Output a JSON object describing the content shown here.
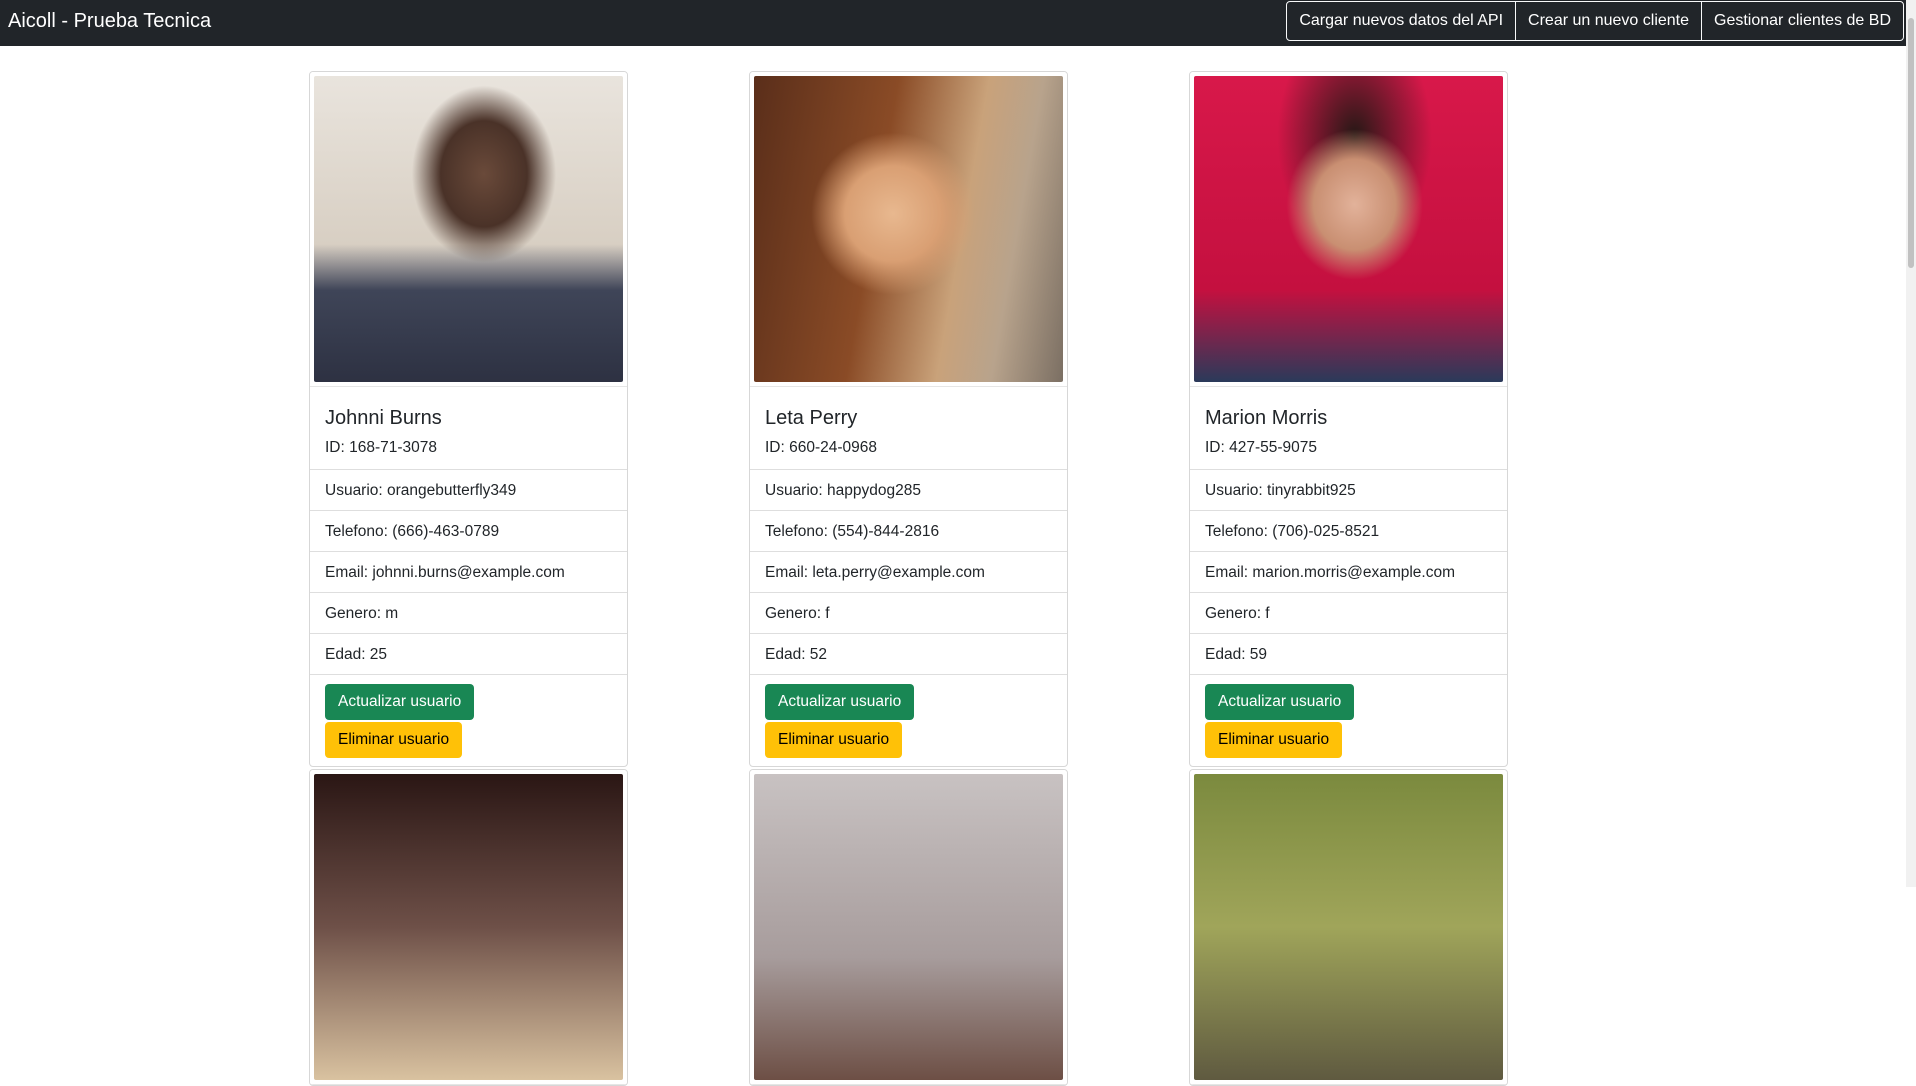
{
  "navbar": {
    "brand": "Aicoll - Prueba Tecnica",
    "buttons": [
      {
        "label": "Cargar nuevos datos del API"
      },
      {
        "label": "Crear un nuevo cliente"
      },
      {
        "label": "Gestionar clientes de BD"
      }
    ]
  },
  "cards": [
    {
      "name": "Johnni Burns",
      "id": "ID: 168-71-3078",
      "user": "Usuario: orangebutterfly349",
      "phone": "Telefono: (666)-463-0789",
      "email": "Email: johnni.burns@example.com",
      "gender": "Genero: m",
      "age": "Edad: 25",
      "update_label": "Actualizar usuario",
      "delete_label": "Eliminar usuario"
    },
    {
      "name": "Leta Perry",
      "id": "ID: 660-24-0968",
      "user": "Usuario: happydog285",
      "phone": "Telefono: (554)-844-2816",
      "email": "Email: leta.perry@example.com",
      "gender": "Genero: f",
      "age": "Edad: 52",
      "update_label": "Actualizar usuario",
      "delete_label": "Eliminar usuario"
    },
    {
      "name": "Marion Morris",
      "id": "ID: 427-55-9075",
      "user": "Usuario: tinyrabbit925",
      "phone": "Telefono: (706)-025-8521",
      "email": "Email: marion.morris@example.com",
      "gender": "Genero: f",
      "age": "Edad: 59",
      "update_label": "Actualizar usuario",
      "delete_label": "Eliminar usuario"
    }
  ],
  "colors": {
    "navbar": "#212529",
    "success": "#198754",
    "warning": "#ffc107"
  }
}
